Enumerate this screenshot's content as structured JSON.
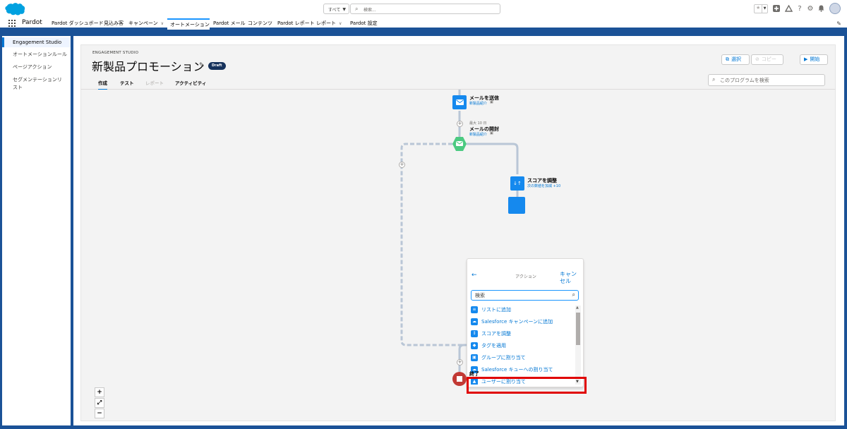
{
  "header": {
    "search_scope": "すべて",
    "search_placeholder": "検索..."
  },
  "nav": {
    "app_name": "Pardot",
    "tabs": [
      {
        "label": "Pardot ダッシュボード"
      },
      {
        "label": "見込み客"
      },
      {
        "label": "キャンペーン"
      },
      {
        "label": "オートメーション"
      },
      {
        "label": "Pardot メール"
      },
      {
        "label": "コンテンツ"
      },
      {
        "label": "Pardot レポート"
      },
      {
        "label": "レポート"
      },
      {
        "label": "Pardot 設定"
      }
    ]
  },
  "left_panel": {
    "items": [
      {
        "label": "Engagement Studio"
      },
      {
        "label": "オートメーションルール"
      },
      {
        "label": "ページアクション"
      },
      {
        "label": "セグメンテーションリスト"
      }
    ]
  },
  "page": {
    "eyebrow": "ENGAGEMENT STUDIO",
    "title": "新製品プロモーション",
    "badge": "Draft",
    "tabs": [
      {
        "label": "作成"
      },
      {
        "label": "テスト"
      },
      {
        "label": "レポート"
      },
      {
        "label": "アクティビティ"
      }
    ],
    "buttons": {
      "select": "選択",
      "copy": "コピー",
      "start": "開始"
    },
    "search_placeholder": "このプログラムを検索"
  },
  "flow": {
    "send_email": {
      "title": "メールを送信",
      "sub": "新製品紹介"
    },
    "email_open": {
      "meta": "最大 10 日",
      "title": "メールの開封",
      "sub": "新製品紹介"
    },
    "adjust_score": {
      "title": "スコアを調整",
      "sub": "次の数値を加減 +10"
    },
    "end": {
      "title": "終了"
    }
  },
  "action_panel": {
    "title": "アクション",
    "cancel": "キャンセル",
    "search_value": "検索",
    "items": [
      {
        "label": "リストに追加"
      },
      {
        "label": "Salesforce キャンペーンに追加"
      },
      {
        "label": "スコアを調整"
      },
      {
        "label": "タグを適用"
      },
      {
        "label": "グループに割り当て"
      },
      {
        "label": "Salesforce キューへの割り当て"
      },
      {
        "label": "ユーザーに割り当て"
      }
    ]
  },
  "colors": {
    "brand_blue": "#0176d3",
    "header_band": "#1b5297",
    "email_node": "#1589ee",
    "trigger_node": "#4bca81",
    "end_node": "#c23934",
    "highlight": "#e00000"
  }
}
